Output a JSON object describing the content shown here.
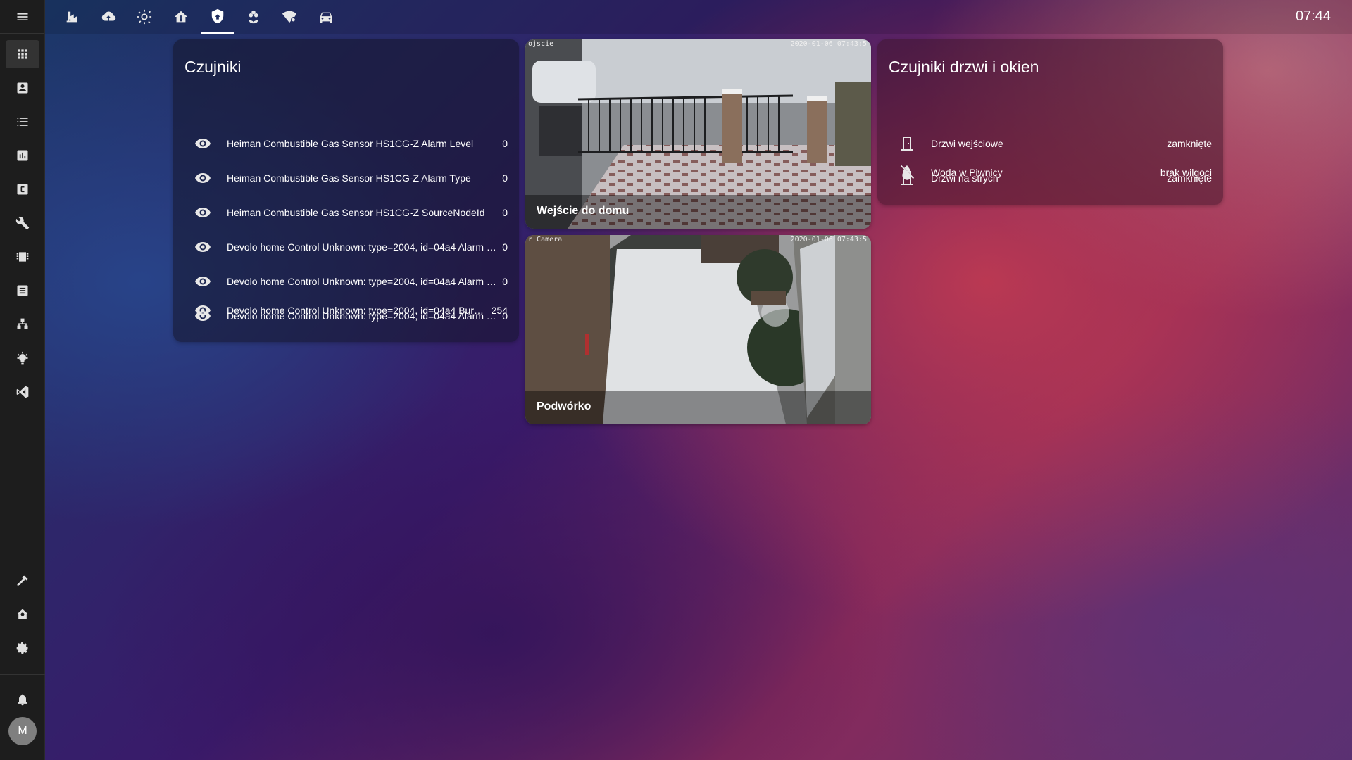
{
  "sidebar": {
    "items": [
      {
        "icon": "apps-icon"
      },
      {
        "icon": "account-box-icon"
      },
      {
        "icon": "format-list-icon"
      },
      {
        "icon": "chart-box-icon"
      },
      {
        "icon": "alpha-c-box-icon"
      },
      {
        "icon": "wrench-icon"
      },
      {
        "icon": "chip-icon"
      },
      {
        "icon": "text-box-icon"
      },
      {
        "icon": "sitemap-icon"
      },
      {
        "icon": "lightbulb-icon"
      },
      {
        "icon": "vscode-icon"
      }
    ],
    "bottom_items": [
      {
        "icon": "hammer-icon"
      },
      {
        "icon": "home-gear-icon"
      },
      {
        "icon": "cog-icon"
      },
      {
        "icon": "bell-icon"
      }
    ],
    "avatar_letter": "M"
  },
  "topbar": {
    "tabs": [
      {
        "icon": "factory-icon"
      },
      {
        "icon": "cloud-upload-icon"
      },
      {
        "icon": "weather-sunny-icon"
      },
      {
        "icon": "home-thermometer-icon"
      },
      {
        "icon": "shield-home-icon",
        "active": true
      },
      {
        "icon": "flower-icon"
      },
      {
        "icon": "wifi-settings-icon"
      },
      {
        "icon": "car-icon"
      }
    ],
    "time": "07:44"
  },
  "sensors_card": {
    "title": "Czujniki",
    "rows": [
      {
        "name": "Heiman Combustible Gas Sensor HS1CG-Z Alarm Level",
        "value": "0"
      },
      {
        "name": "Heiman Combustible Gas Sensor HS1CG-Z Alarm Type",
        "value": "0"
      },
      {
        "name": "Heiman Combustible Gas Sensor HS1CG-Z SourceNodeId",
        "value": "0"
      },
      {
        "name": "Devolo home Control Unknown: type=2004, id=04a4 Alarm L...",
        "value": "0"
      },
      {
        "name": "Devolo home Control Unknown: type=2004, id=04a4 Alarm L...",
        "value": "0"
      },
      {
        "name": "Devolo home Control Unknown: type=2004, id=04a4 Alarm Ty...",
        "value": "0"
      },
      {
        "name": "Devolo home Control Unknown: type=2004, id=04a4 Burglar",
        "value": "254"
      }
    ]
  },
  "cameras": [
    {
      "caption": "Wejście do domu",
      "stamp": "2020-01-06 07:43:5",
      "label": "ojscie"
    },
    {
      "caption": "Podwórko",
      "stamp": "2020-01-06 07:43:5",
      "label": "r Camera"
    }
  ],
  "doors_card": {
    "title": "Czujniki drzwi i okien",
    "rows": [
      {
        "icon": "door-closed-icon",
        "name": "Drzwi wejściowe",
        "value": "zamknięte"
      },
      {
        "icon": "door-closed-icon",
        "name": "Drzwi na strych",
        "value": "zamknięte"
      },
      {
        "icon": "water-off-icon",
        "name": "Woda w Piwnicy",
        "value": "brak wilgoci"
      }
    ]
  }
}
